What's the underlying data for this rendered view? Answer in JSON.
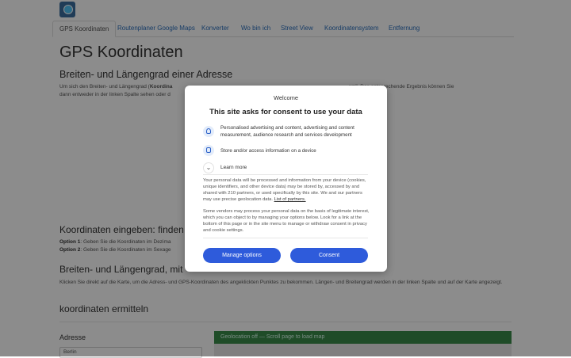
{
  "nav": {
    "tabs": [
      {
        "label": "GPS Koordinaten",
        "active": true
      },
      {
        "label": "Routenplaner Google Maps"
      },
      {
        "label": "Konverter"
      },
      {
        "label": "Wo bin ich"
      },
      {
        "label": "Street View"
      },
      {
        "label": "Koordinatensystem"
      },
      {
        "label": "Entfernung"
      }
    ]
  },
  "main": {
    "title": "GPS Koordinaten",
    "section1_heading": "Breiten- und Längengrad einer Adresse",
    "section1_text_a": "Um sich den Breiten- und Längengrad (",
    "section1_text_bold": "Koordina",
    "section1_text_b": "em\". Das entsprechende Ergebnis können Sie",
    "section1_text_c": "dann entweder in der linken Spalte sehen oder d",
    "section2_heading": "Koordinaten eingeben: finden",
    "option1_label": "Option 1",
    "option1_text": ": Geben Sie die Koordinaten im Dezima",
    "option2_label": "Option 2",
    "option2_text": ": Geben Sie die Koordinaten im Sexage",
    "section3_heading": "Breiten- und Längengrad, mit",
    "section3_text": "Klicken Sie direkt auf die Karte, um die Adress- und GPS-Koordinaten des angeklickten Punktes zu bekommen. Längen- und Breitengrad werden in der linken Spalte und auf der Karte angezeigt.",
    "section4_heading": "koordinaten ermitteln",
    "address_label": "Adresse",
    "address_value": "Berlin",
    "geo_bar": "Geolocation off — Scroll page to load map"
  },
  "consent": {
    "welcome": "Welcome",
    "title": "This site asks for consent to use your data",
    "purpose1": "Personalised advertising and content, advertising and content measurement, audience research and services development",
    "purpose2": "Store and/or access information on a device",
    "learn_more": "Learn more",
    "text1": "Your personal data will be processed and information from your device (cookies, unique identifiers, and other device data) may be stored by, accessed by and shared with 210 partners, or used specifically by this site. We and our partners may use precise geolocation data.",
    "partners_link": "List of partners.",
    "text2": "Some vendors may process your personal data on the basis of legitimate interest, which you can object to by managing your options below. Look for a link at the bottom of this page or in the site menu to manage or withdraw consent in privacy and cookie settings.",
    "manage_button": "Manage options",
    "consent_button": "Consent"
  },
  "colors": {
    "link": "#2a6ebb",
    "consent_button": "#2e5bdb",
    "geo_bar": "#3a8a4a"
  }
}
